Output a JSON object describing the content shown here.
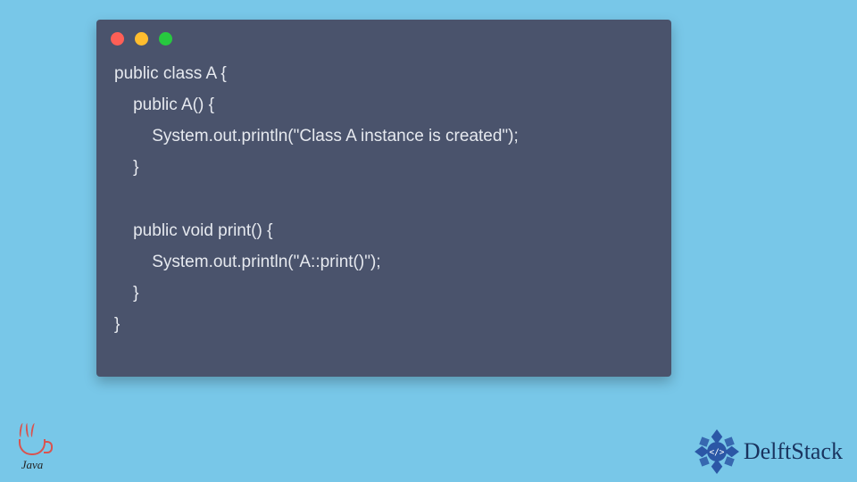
{
  "colors": {
    "page_bg": "#78c7e8",
    "window_bg": "#4a536c",
    "code_fg": "#e6e9ef",
    "dot_red": "#ff5f56",
    "dot_yellow": "#ffbd2e",
    "dot_green": "#27c93f",
    "java_accent": "#d9534f",
    "brand_navy": "#19335e"
  },
  "code_lines": [
    "public class A {",
    "    public A() {",
    "        System.out.println(\"Class A instance is created\");",
    "    }",
    "",
    "    public void print() {",
    "        System.out.println(\"A::print()\");",
    "    }",
    "}"
  ],
  "java_label": "Java",
  "brand_name": "DelftStack",
  "brand_glyph": "</>"
}
